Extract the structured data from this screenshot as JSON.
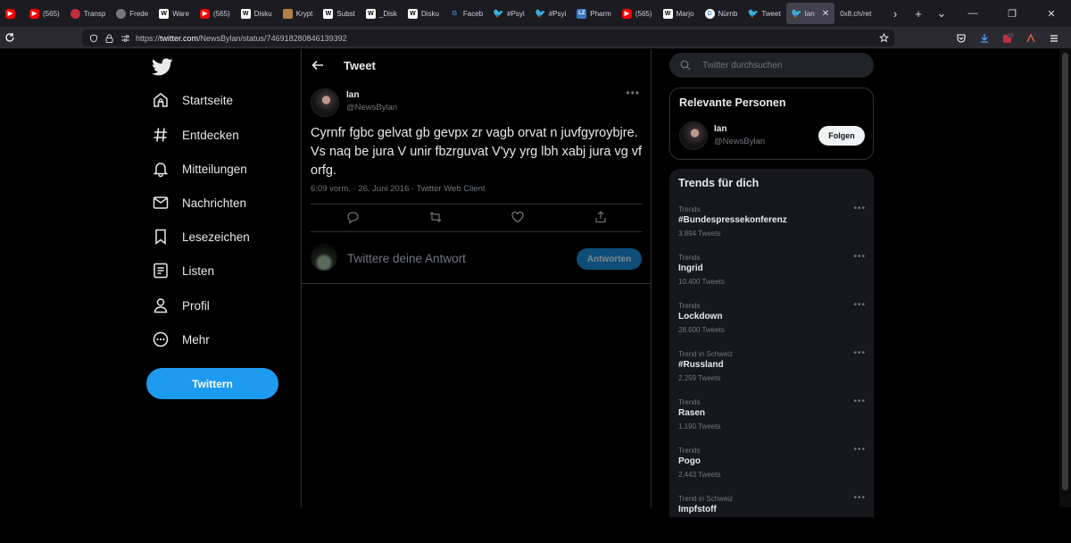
{
  "browser": {
    "tabs": [
      {
        "label": "",
        "icon": "youtube-icon",
        "fav": "fav-yt"
      },
      {
        "label": "(565)",
        "icon": "youtube-icon",
        "fav": "fav-yt"
      },
      {
        "label": "Transp",
        "icon": "red-circle-icon",
        "fav": "fav-red"
      },
      {
        "label": "Frede",
        "icon": "grey-avatar-icon",
        "fav": "fav-grey"
      },
      {
        "label": "Ware",
        "icon": "wikipedia-icon",
        "fav": "fav-w"
      },
      {
        "label": "(565)",
        "icon": "youtube-icon",
        "fav": "fav-yt"
      },
      {
        "label": "Disku",
        "icon": "wikipedia-icon",
        "fav": "fav-w"
      },
      {
        "label": "Krypt",
        "icon": "crypto-icon",
        "fav": "fav-orange"
      },
      {
        "label": "Subst",
        "icon": "wikipedia-icon",
        "fav": "fav-w"
      },
      {
        "label": "_Disk",
        "icon": "wikipedia-icon",
        "fav": "fav-w"
      },
      {
        "label": "Disku",
        "icon": "wikipedia-icon",
        "fav": "fav-w"
      },
      {
        "label": "Faceb",
        "icon": "google-icon",
        "fav": "fav-fb"
      },
      {
        "label": "#Psyi",
        "icon": "twitter-icon",
        "fav": "fav-tw"
      },
      {
        "label": "#Psyi",
        "icon": "twitter-icon",
        "fav": "fav-tw"
      },
      {
        "label": "Pharm",
        "icon": "lz-icon",
        "fav": "fav-lz"
      },
      {
        "label": "(565)",
        "icon": "youtube-icon",
        "fav": "fav-yt"
      },
      {
        "label": "Marjo",
        "icon": "wikipedia-icon",
        "fav": "fav-w"
      },
      {
        "label": "Nürnb",
        "icon": "google-icon",
        "fav": "fav-g"
      },
      {
        "label": "Tweet",
        "icon": "twitter-icon",
        "fav": "fav-tw"
      },
      {
        "label": "Ian",
        "icon": "twitter-icon",
        "fav": "fav-tw",
        "active": true
      },
      {
        "label": "0x8.ch/ret",
        "icon": "",
        "fav": ""
      }
    ],
    "url_prefix": "https://",
    "url_host": "twitter.com",
    "url_path": "/NewsBylan/status/746918280846139392"
  },
  "nav": {
    "items": [
      {
        "label": "Startseite",
        "icon": "home-icon"
      },
      {
        "label": "Entdecken",
        "icon": "hashtag-icon"
      },
      {
        "label": "Mitteilungen",
        "icon": "bell-icon"
      },
      {
        "label": "Nachrichten",
        "icon": "mail-icon"
      },
      {
        "label": "Lesezeichen",
        "icon": "bookmark-icon"
      },
      {
        "label": "Listen",
        "icon": "list-icon"
      },
      {
        "label": "Profil",
        "icon": "profile-icon"
      },
      {
        "label": "Mehr",
        "icon": "more-circle-icon"
      }
    ],
    "tweet_button": "Twittern"
  },
  "main": {
    "title": "Tweet",
    "tweet": {
      "name": "Ian",
      "handle": "@NewsBylan",
      "text": "Cyrnfr fgbc gelvat gb gevpx zr vagb orvat n juvfgyroybjre. Vs naq be jura V unir fbzrguvat V'yy yrg lbh xabj jura vg vf orfg.",
      "meta": "6:09 vorm. · 26. Juni 2016 · Twitter Web Client"
    },
    "reply": {
      "placeholder": "Twittere deine Antwort",
      "button": "Antworten"
    }
  },
  "right": {
    "search_placeholder": "Twitter durchsuchen",
    "people": {
      "title": "Relevante Personen",
      "name": "Ian",
      "handle": "@NewsBylan",
      "follow": "Folgen"
    },
    "trends": {
      "title": "Trends für dich",
      "items": [
        {
          "category": "Trends",
          "name": "#Bundespressekonferenz",
          "count": "3.894 Tweets"
        },
        {
          "category": "Trends",
          "name": "Ingrid",
          "count": "10.400 Tweets"
        },
        {
          "category": "Trends",
          "name": "Lockdown",
          "count": "28.600 Tweets"
        },
        {
          "category": "Trend in Schweiz",
          "name": "#Russland",
          "count": "2.259 Tweets"
        },
        {
          "category": "Trends",
          "name": "Rasen",
          "count": "1.190 Tweets"
        },
        {
          "category": "Trends",
          "name": "Pogo",
          "count": "2.443 Tweets"
        },
        {
          "category": "Trend in Schweiz",
          "name": "Impfstoff",
          "count": ""
        }
      ]
    }
  },
  "colors": {
    "accent": "#1d9bf0",
    "background": "#000000",
    "border": "#2f3336",
    "muted": "#71767b"
  }
}
